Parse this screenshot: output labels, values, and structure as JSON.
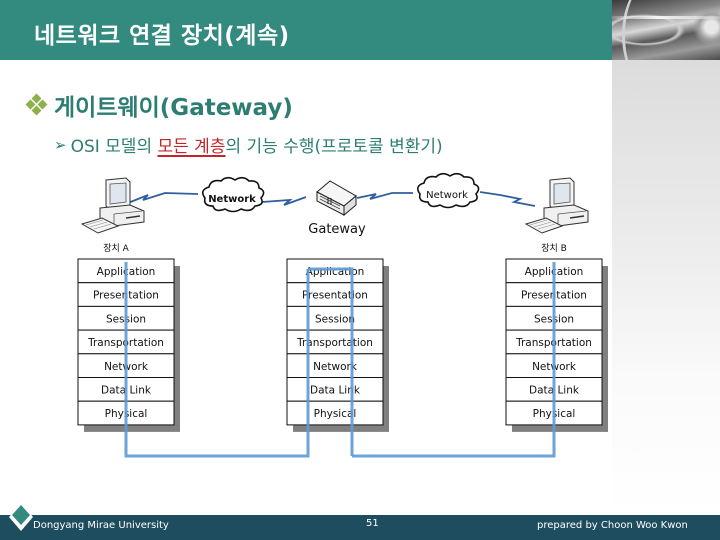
{
  "header": {
    "title": "네트워크 연결 장치(계속)"
  },
  "content": {
    "bullet1": {
      "icon": "diamond-cluster-bullet",
      "text": "게이트웨이(Gateway)"
    },
    "bullet2": {
      "icon": "arrowhead-bullet",
      "prefix": "OSI 모델의 ",
      "highlight": "모든 계층",
      "suffix": "의 기능 수행(프로토콜 변환기)"
    }
  },
  "diagram": {
    "device_a_label": "장치 A",
    "device_b_label": "장치 B",
    "gateway_label": "Gateway",
    "cloud_left_label": "Network",
    "cloud_right_label": "Network",
    "osi_layers": [
      "Application",
      "Presentation",
      "Session",
      "Transportation",
      "Network",
      "Data Link",
      "Physical"
    ],
    "colors": {
      "path_line": "#5b9bd5",
      "link_line": "#2e5f9e",
      "shadow": "#808080"
    }
  },
  "footer": {
    "left_text": "Dongyang Mirae University",
    "page_number": "51",
    "right_text": "prepared by Choon Woo Kwon"
  },
  "colors": {
    "header_bg": "#338a7f",
    "accent_text": "#2e7d73",
    "bullet_green": "#8db04a",
    "highlight_red": "#c0272d",
    "footer_bg": "#1e4d5f"
  }
}
